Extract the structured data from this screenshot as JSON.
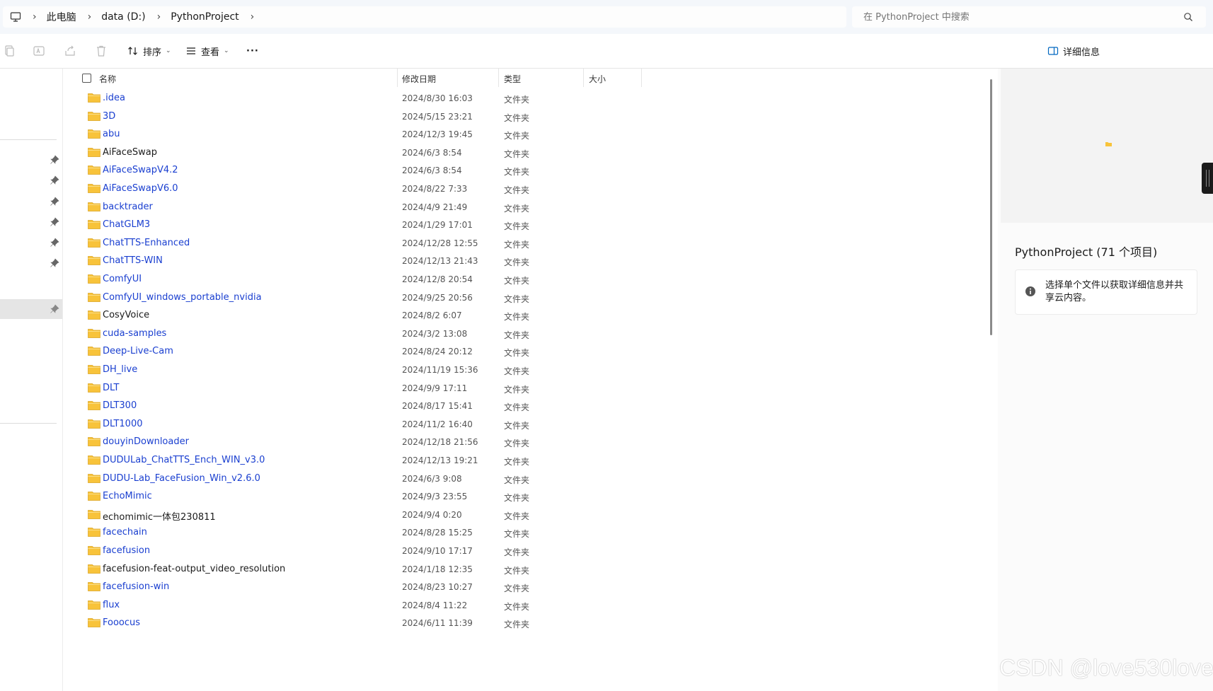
{
  "address": {
    "crumbs": [
      "此电脑",
      "data (D:)",
      "PythonProject"
    ],
    "search_placeholder": "在 PythonProject 中搜索"
  },
  "toolbar": {
    "sort_label": "排序",
    "view_label": "查看",
    "more_label": "···",
    "details_label": "详细信息"
  },
  "columns": {
    "name": "名称",
    "date": "修改日期",
    "type": "类型",
    "size": "大小"
  },
  "files": [
    {
      "name": ".idea",
      "date": "2024/8/30 16:03",
      "type": "文件夹"
    },
    {
      "name": "3D",
      "date": "2024/5/15 23:21",
      "type": "文件夹"
    },
    {
      "name": "abu",
      "date": "2024/12/3 19:45",
      "type": "文件夹"
    },
    {
      "name": "AiFaceSwap",
      "date": "2024/6/3 8:54",
      "type": "文件夹"
    },
    {
      "name": "AiFaceSwapV4.2",
      "date": "2024/6/3 8:54",
      "type": "文件夹"
    },
    {
      "name": "AiFaceSwapV6.0",
      "date": "2024/8/22 7:33",
      "type": "文件夹"
    },
    {
      "name": "backtrader",
      "date": "2024/4/9 21:49",
      "type": "文件夹"
    },
    {
      "name": "ChatGLM3",
      "date": "2024/1/29 17:01",
      "type": "文件夹"
    },
    {
      "name": "ChatTTS-Enhanced",
      "date": "2024/12/28 12:55",
      "type": "文件夹"
    },
    {
      "name": "ChatTTS-WIN",
      "date": "2024/12/13 21:43",
      "type": "文件夹"
    },
    {
      "name": "ComfyUI",
      "date": "2024/12/8 20:54",
      "type": "文件夹"
    },
    {
      "name": "ComfyUI_windows_portable_nvidia",
      "date": "2024/9/25 20:56",
      "type": "文件夹"
    },
    {
      "name": "CosyVoice",
      "date": "2024/8/2 6:07",
      "type": "文件夹"
    },
    {
      "name": "cuda-samples",
      "date": "2024/3/2 13:08",
      "type": "文件夹"
    },
    {
      "name": "Deep-Live-Cam",
      "date": "2024/8/24 20:12",
      "type": "文件夹"
    },
    {
      "name": "DH_live",
      "date": "2024/11/19 15:36",
      "type": "文件夹"
    },
    {
      "name": "DLT",
      "date": "2024/9/9 17:11",
      "type": "文件夹"
    },
    {
      "name": "DLT300",
      "date": "2024/8/17 15:41",
      "type": "文件夹"
    },
    {
      "name": "DLT1000",
      "date": "2024/11/2 16:40",
      "type": "文件夹"
    },
    {
      "name": "douyinDownloader",
      "date": "2024/12/18 21:56",
      "type": "文件夹"
    },
    {
      "name": "DUDULab_ChatTTS_Ench_WIN_v3.0",
      "date": "2024/12/13 19:21",
      "type": "文件夹"
    },
    {
      "name": "DUDU-Lab_FaceFusion_Win_v2.6.0",
      "date": "2024/6/3 9:08",
      "type": "文件夹"
    },
    {
      "name": "EchoMimic",
      "date": "2024/9/3 23:55",
      "type": "文件夹"
    },
    {
      "name": "echomimic一体包230811",
      "date": "2024/9/4 0:20",
      "type": "文件夹"
    },
    {
      "name": "facechain",
      "date": "2024/8/28 15:25",
      "type": "文件夹"
    },
    {
      "name": "facefusion",
      "date": "2024/9/10 17:17",
      "type": "文件夹"
    },
    {
      "name": "facefusion-feat-output_video_resolution",
      "date": "2024/1/18 12:35",
      "type": "文件夹"
    },
    {
      "name": "facefusion-win",
      "date": "2024/8/23 10:27",
      "type": "文件夹"
    },
    {
      "name": "flux",
      "date": "2024/8/4 11:22",
      "type": "文件夹"
    },
    {
      "name": "Fooocus",
      "date": "2024/6/11 11:39",
      "type": "文件夹"
    }
  ],
  "details": {
    "title": "PythonProject (71 个项目)",
    "info": "选择单个文件以获取详细信息并共享云内容。"
  },
  "watermark": "CSDN @love530love",
  "colors": {
    "link": "#1a3fd0",
    "folder": "#f8c33a",
    "accent": "#0067c0"
  }
}
